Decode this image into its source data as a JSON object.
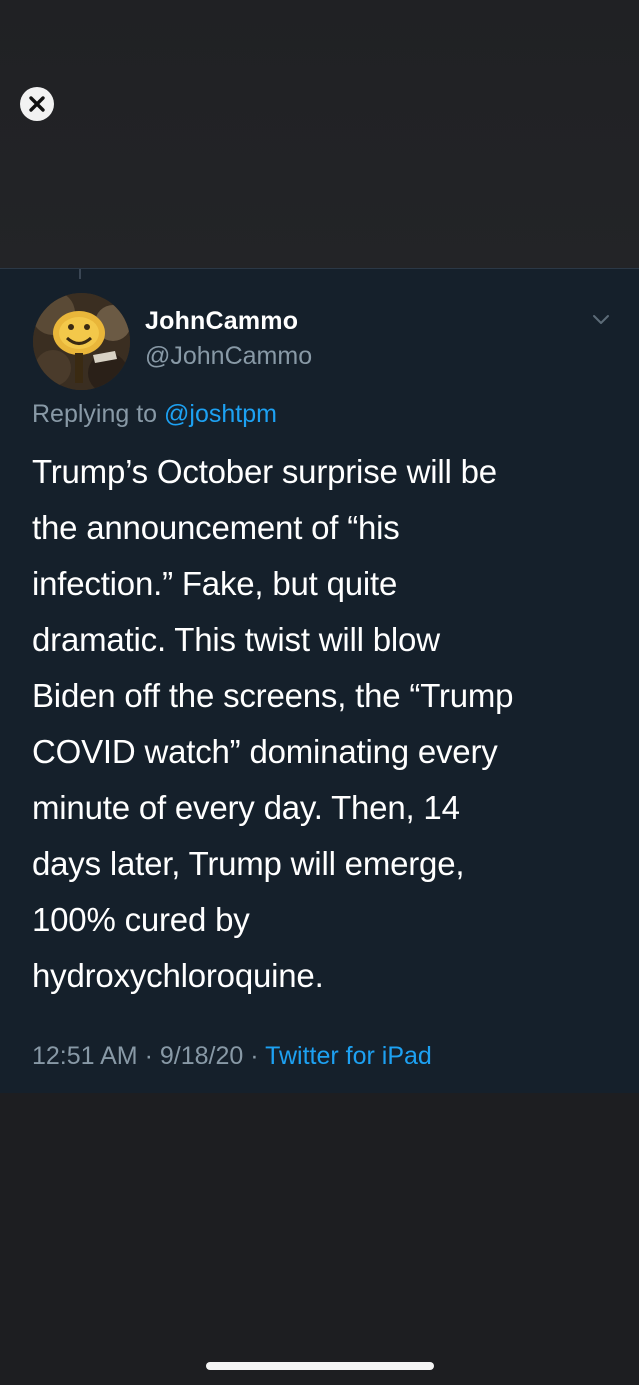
{
  "viewer": {
    "close_icon": "close-x-icon"
  },
  "tweet": {
    "display_name": "JohnCammo",
    "handle": "@JohnCammo",
    "replying_prefix": "Replying to",
    "replying_mention": "@joshtpm",
    "body_lines": [
      "Trump’s October surprise will be",
      "the announcement of “his",
      "infection.”  Fake, but quite",
      "dramatic. This twist will blow",
      "Biden off the screens, the “Trump",
      "COVID watch” dominating every",
      "minute of every day.  Then, 14",
      "days later, Trump will emerge,",
      "100% cured by",
      "hydroxychloroquine."
    ],
    "time": "12:51 AM",
    "date": "9/18/20",
    "separator": "·",
    "source": "Twitter for iPad",
    "more_icon": "chevron-down-icon",
    "link_color": "#1da1f2",
    "background_color": "#15202b"
  }
}
